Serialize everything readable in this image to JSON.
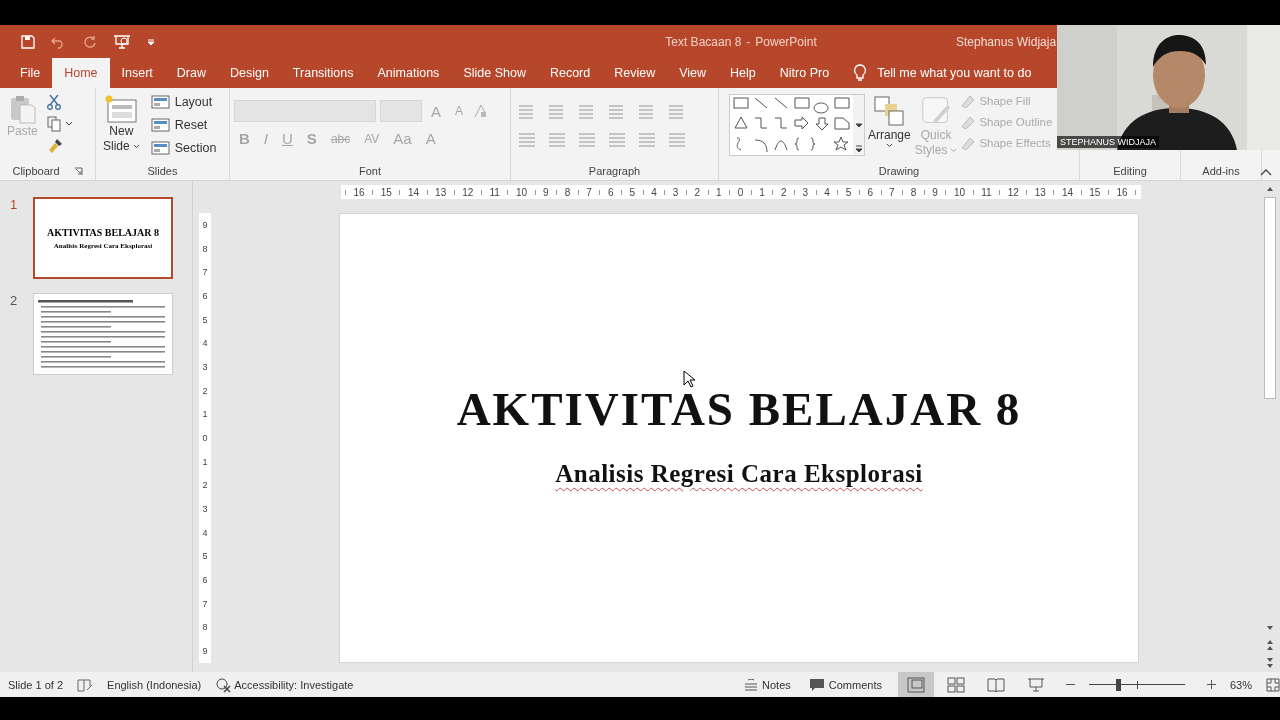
{
  "title_bar": {
    "document": "Text Bacaan 8",
    "separator": "-",
    "app": "PowerPoint",
    "user": "Stephanus Widjaja"
  },
  "tabs": [
    {
      "label": "File",
      "selected": false
    },
    {
      "label": "Home",
      "selected": true
    },
    {
      "label": "Insert",
      "selected": false
    },
    {
      "label": "Draw",
      "selected": false
    },
    {
      "label": "Design",
      "selected": false
    },
    {
      "label": "Transitions",
      "selected": false
    },
    {
      "label": "Animations",
      "selected": false
    },
    {
      "label": "Slide Show",
      "selected": false
    },
    {
      "label": "Record",
      "selected": false
    },
    {
      "label": "Review",
      "selected": false
    },
    {
      "label": "View",
      "selected": false
    },
    {
      "label": "Help",
      "selected": false
    },
    {
      "label": "Nitro Pro",
      "selected": false
    }
  ],
  "tell_me": "Tell me what you want to do",
  "ribbon": {
    "clipboard": {
      "label": "Clipboard",
      "paste": {
        "label": "Paste",
        "disabled": true
      }
    },
    "slides": {
      "label": "Slides",
      "new_slide": [
        "New",
        "Slide"
      ],
      "buttons": [
        "Layout",
        "Reset",
        "Section"
      ]
    },
    "font": {
      "label": "Font",
      "disabled": true,
      "size_buttons": [
        "A",
        "A"
      ],
      "format_buttons": [
        "B",
        "I",
        "U",
        "S",
        "abc",
        "AV",
        "Aa",
        "A"
      ]
    },
    "paragraph": {
      "label": "Paragraph"
    },
    "drawing": {
      "label": "Drawing",
      "arrange": "Arrange",
      "quick_styles": {
        "lines": [
          "Quick",
          "Styles"
        ],
        "disabled": true
      },
      "shape_buttons": [
        {
          "label": "Shape Fill",
          "disabled": true
        },
        {
          "label": "Shape Outline",
          "disabled": true
        },
        {
          "label": "Shape Effects",
          "disabled": true
        }
      ]
    },
    "editing": {
      "label": "Editing"
    },
    "addins": {
      "label": "Add-ins"
    }
  },
  "slides": [
    {
      "number": "1",
      "selected": true,
      "kind": "title",
      "title": "AKTIVITAS BELAJAR 8",
      "subtitle": "Analisis Regresi Cara Eksplorasi"
    },
    {
      "number": "2",
      "selected": false,
      "kind": "list"
    }
  ],
  "ruler": {
    "horizontal": [
      "16",
      "15",
      "14",
      "13",
      "12",
      "11",
      "10",
      "9",
      "8",
      "7",
      "6",
      "5",
      "4",
      "3",
      "2",
      "1",
      "0",
      "1",
      "2",
      "3",
      "4",
      "5",
      "6",
      "7",
      "8",
      "9",
      "10",
      "11",
      "12",
      "13",
      "14",
      "15",
      "16"
    ],
    "vertical": [
      "9",
      "8",
      "7",
      "6",
      "5",
      "4",
      "3",
      "2",
      "1",
      "0",
      "1",
      "2",
      "3",
      "4",
      "5",
      "6",
      "7",
      "8",
      "9"
    ]
  },
  "slide": {
    "title": "AKTIVITAS BELAJAR 8",
    "subtitle": "Analisis Regresi Cara Eksplorasi"
  },
  "webcam": {
    "name": "STEPHANUS WIDJAJA"
  },
  "status_bar": {
    "position": "Slide 1 of 2",
    "language": "English (Indonesia)",
    "accessibility": "Accessibility: Investigate",
    "notes": "Notes",
    "comments": "Comments",
    "views": [
      {
        "kind": "normal",
        "selected": true
      },
      {
        "kind": "sorter",
        "selected": false
      },
      {
        "kind": "reading",
        "selected": false
      },
      {
        "kind": "slideshow",
        "selected": false
      }
    ],
    "zoom": {
      "level": 0.3,
      "reading": "63%"
    }
  }
}
